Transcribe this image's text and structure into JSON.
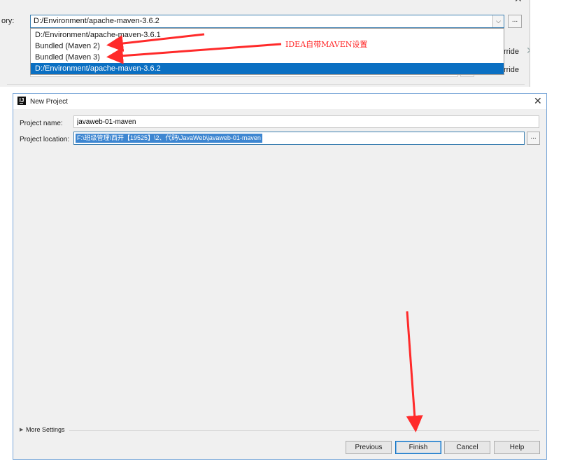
{
  "settings": {
    "home_label": "ory:",
    "home_value": "D:/Environment/apache-maven-3.6.2",
    "browse_label": "...",
    "override_1": "rride",
    "override_2": "rride",
    "close_glyph": "✕",
    "dropdown_items": [
      {
        "label": "D:/Environment/apache-maven-3.6.1",
        "selected": false
      },
      {
        "label": "Bundled (Maven 2)",
        "selected": false
      },
      {
        "label": "Bundled (Maven 3)",
        "selected": false
      },
      {
        "label": "D:/Environment/apache-maven-3.6.2",
        "selected": true
      }
    ]
  },
  "annotation": {
    "text": "IDEA自带MAVEN设置",
    "color": "#ff2a2a"
  },
  "dialog": {
    "title": "New Project",
    "app_icon": "IJ",
    "close_glyph": "✕",
    "project_name_label": "Project name:",
    "project_name_value": "javaweb-01-maven",
    "project_location_label": "Project location:",
    "project_location_value": "F:\\班级管理\\西开【19525】\\2、代码\\JavaWeb\\javaweb-01-maven",
    "browse_label": "...",
    "more_settings_label": "More Settings",
    "buttons": {
      "previous": "Previous",
      "finish": "Finish",
      "cancel": "Cancel",
      "help": "Help"
    }
  },
  "colors": {
    "selection": "#0a6fc2",
    "dialog_bg": "#f0f0f0",
    "arrow": "#ff2a2a"
  }
}
